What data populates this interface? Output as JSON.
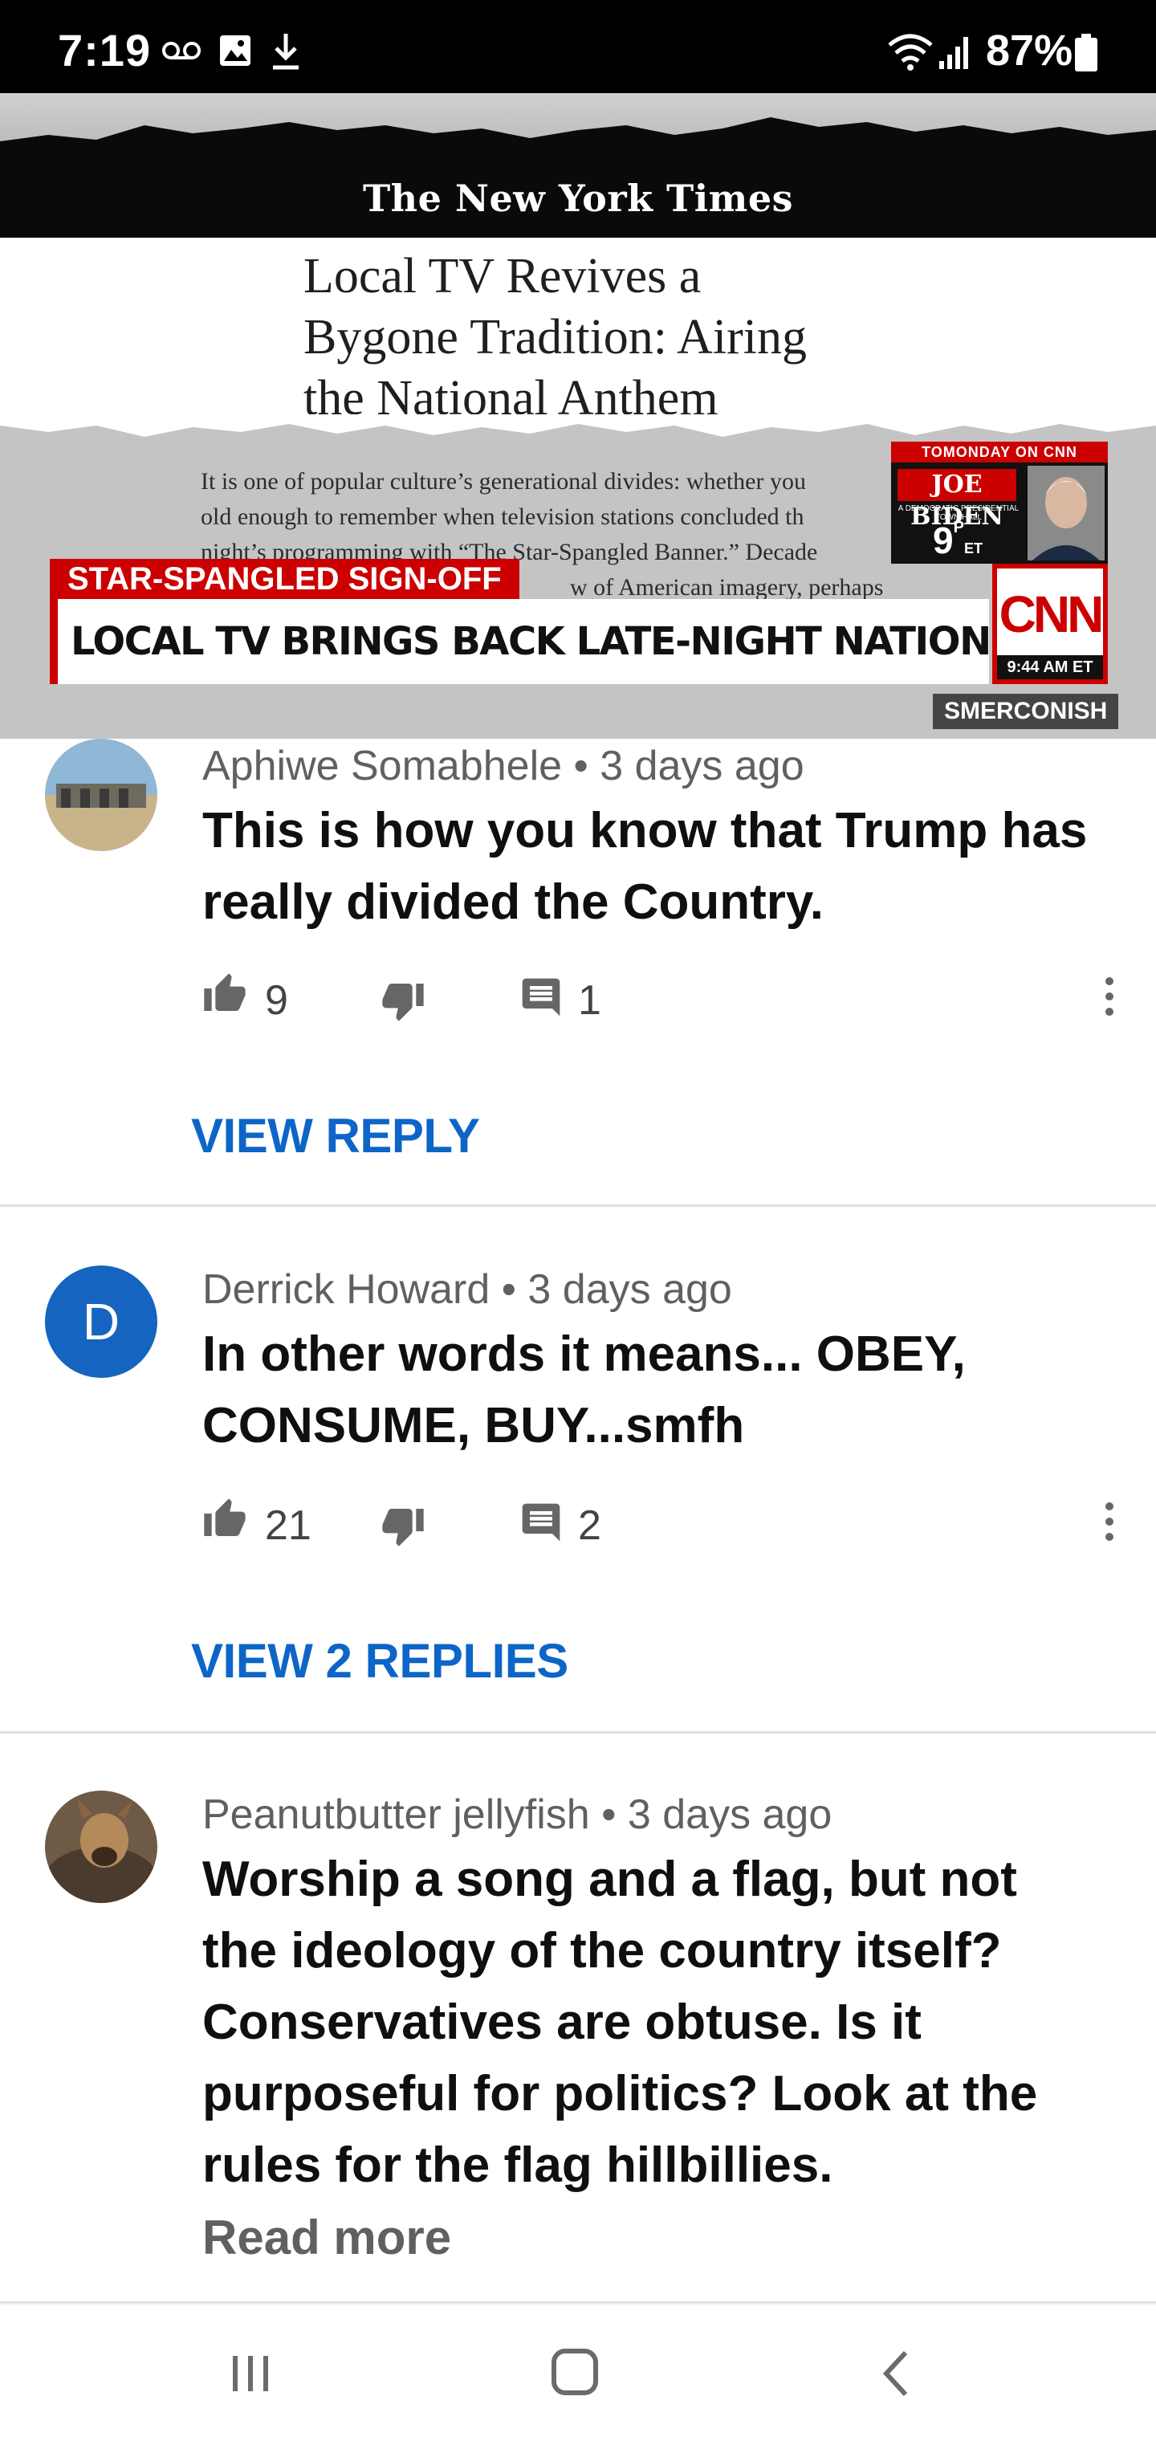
{
  "status_bar": {
    "time": "7:19",
    "battery": "87%",
    "icons": [
      "voicemail-icon",
      "image-icon",
      "download-icon",
      "wifi-icon",
      "signal-icon",
      "battery-icon"
    ]
  },
  "video": {
    "newspaper_logo": "The New York Times",
    "headline": [
      "Local TV Revives a",
      "Bygone Tradition: Airing",
      "the National Anthem"
    ],
    "article_lines": [
      "It is one of popular culture’s generational divides: whether you",
      "old enough to remember when television stations concluded th",
      "night’s programming with “The Star-Spangled Banner.” Decade",
      "w of American imagery, perhaps"
    ],
    "promo": {
      "top": "TOMONDAY ON CNN",
      "name": "JOE BIDEN",
      "sub": "A DEMOCRATIC PRESIDENTIAL TOWN HALL",
      "time": "9",
      "time_suffix": "P",
      "time_zone": "ET"
    },
    "lower_third_tag": "STAR-SPANGLED SIGN-OFF",
    "lower_third": "LOCAL TV BRINGS BACK LATE-NIGHT NATIONAL ANTHEM",
    "network_logo": "CNN",
    "clock": "9:44 AM ET",
    "show_name": "SMERCONISH",
    "progress": 0.06,
    "colors": {
      "cnn_red": "#cc0000",
      "progress_red": "#ff0000"
    }
  },
  "comments": [
    {
      "author": "Aphiwe Somabhele",
      "age": "3 days ago",
      "lines": [
        "This is how you know that Trump has",
        "really divided the Country."
      ],
      "likes": "9",
      "replies": "1",
      "view_replies": "VIEW REPLY"
    },
    {
      "author": "Derrick Howard",
      "age": "3 days ago",
      "avatar_letter": "D",
      "lines": [
        "In other words it means... OBEY,",
        "CONSUME, BUY...smfh"
      ],
      "likes": "21",
      "replies": "2",
      "view_replies": "VIEW 2 REPLIES"
    },
    {
      "author": "Peanutbutter jellyfish",
      "age": "3 days ago",
      "lines": [
        "Worship a song and a flag, but not",
        "the ideology of the country itself?",
        "Conservatives are obtuse. Is it",
        "purposeful for politics? Look at the",
        "rules for the flag hillbillies."
      ],
      "read_more": "Read more"
    }
  ],
  "separator": "•",
  "accent_color": "#0d65c7"
}
